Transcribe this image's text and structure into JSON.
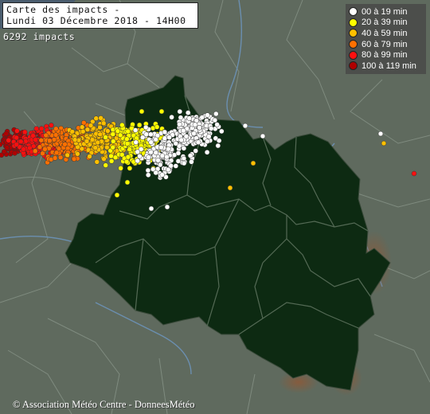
{
  "header": {
    "title_line1": "Carte des impacts -",
    "title_line2": "Lundi 03 Décembre 2018 - 14H00",
    "impact_count": "6292 impacts"
  },
  "legend": {
    "items": [
      {
        "label": "00 à 19 min",
        "color": "#ffffff"
      },
      {
        "label": "20 à 39 min",
        "color": "#ffff00"
      },
      {
        "label": "40 à 59 min",
        "color": "#ffc000"
      },
      {
        "label": "60 à 79 min",
        "color": "#ff7000"
      },
      {
        "label": "80 à 99 min",
        "color": "#ff1010"
      },
      {
        "label": "100 à 119 min",
        "color": "#b00000"
      }
    ]
  },
  "footer": {
    "credit": "© Association Météo Centre - DonneesMétéo"
  },
  "colors": {
    "background_land": "#5f6a5e",
    "region_fill": "#0d2a12",
    "border_line": "#7a8a7a",
    "river_line": "#6b8fb0"
  }
}
